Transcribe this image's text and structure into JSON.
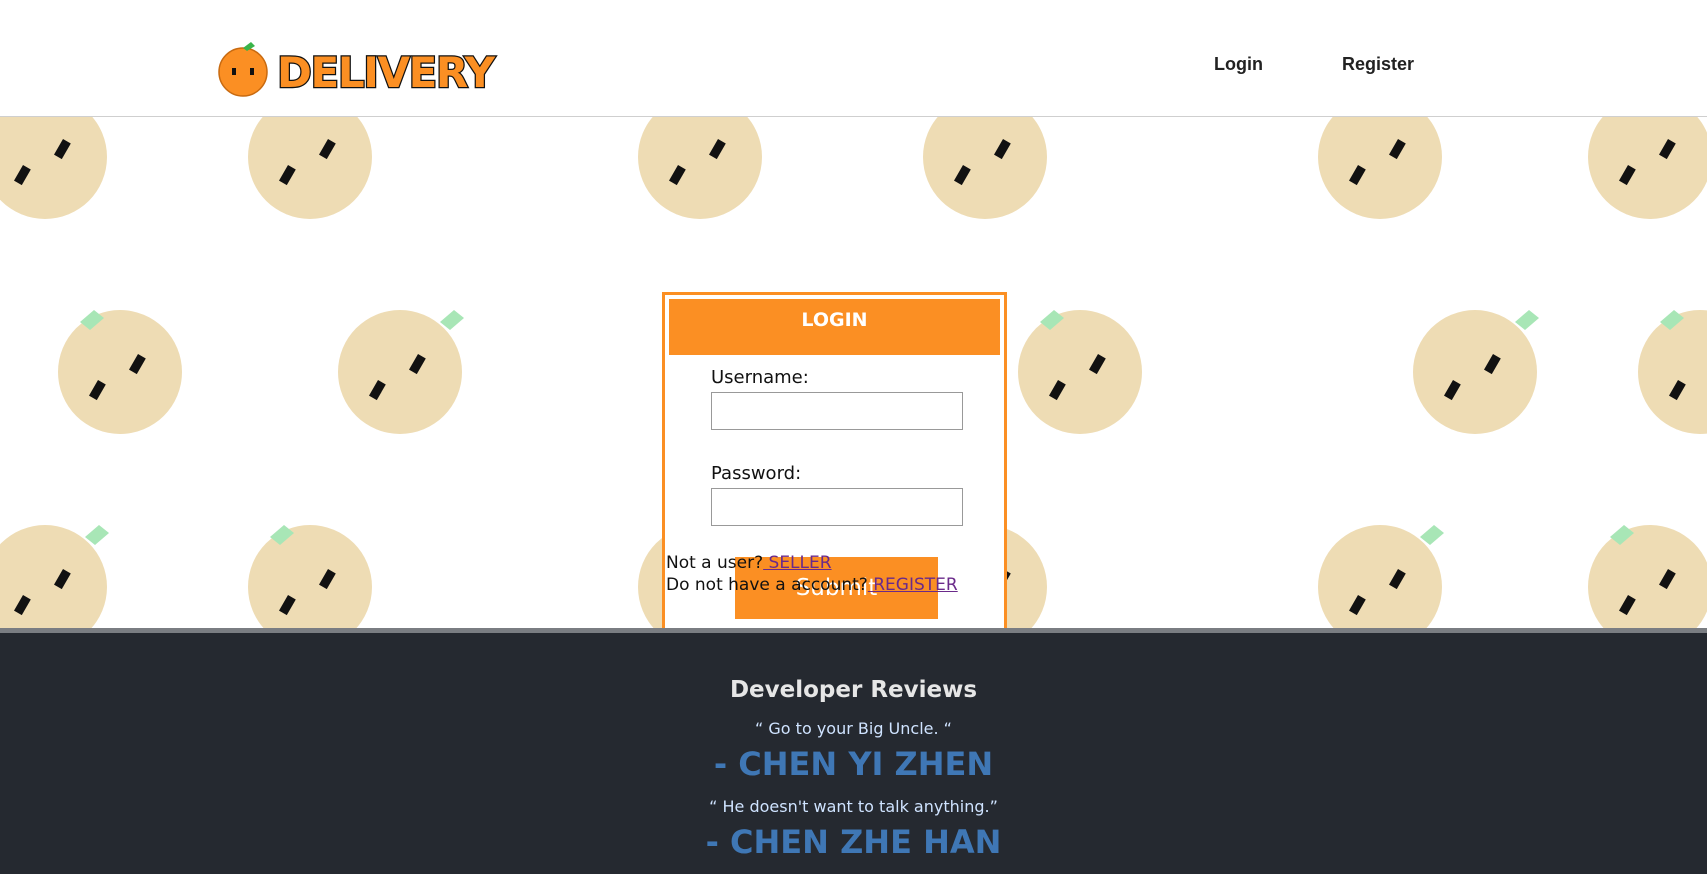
{
  "header": {
    "logo_text": "DELIVERY",
    "nav": {
      "login": "Login",
      "register": "Register"
    }
  },
  "login": {
    "title": "LOGIN",
    "username_label": "Username:",
    "username_value": "",
    "password_label": "Password:",
    "password_value": "",
    "submit_label": "Submit"
  },
  "links": {
    "not_user_text": "Not a user?",
    "seller_link": " SELLER",
    "no_account_text": "Do not have a account?",
    "register_link": " REGISTER"
  },
  "footer": {
    "title": "Developer Reviews",
    "reviews": [
      {
        "quote": "“ Go to your Big Uncle. “",
        "author": "- CHEN YI ZHEN"
      },
      {
        "quote": "“ He doesn't want to talk anything.”",
        "author": "- CHEN ZHE HAN"
      }
    ]
  },
  "colors": {
    "accent": "#fb8f23",
    "footer_bg": "#252930",
    "author": "#3f77b5",
    "pattern": "#eedcb4",
    "leaf": "#a8e6b6"
  }
}
